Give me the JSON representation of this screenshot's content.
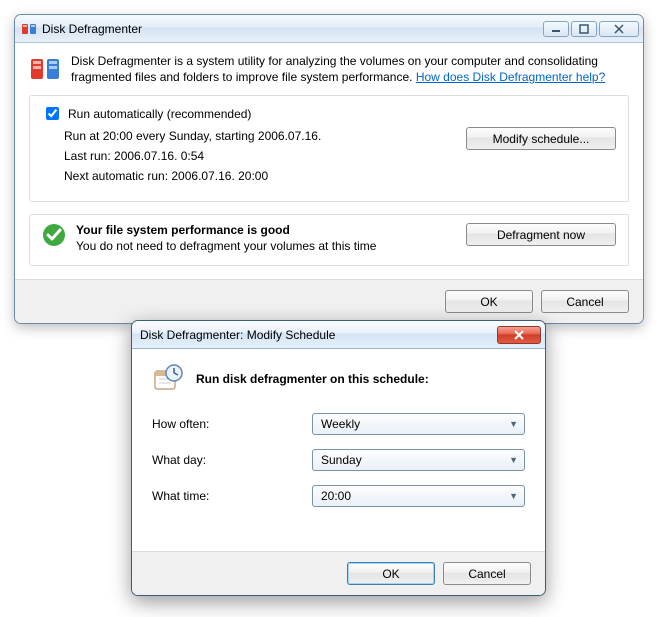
{
  "main": {
    "title": "Disk Defragmenter",
    "intro_text": "Disk Defragmenter is a system utility for analyzing the volumes on your computer and consolidating fragmented files and folders to improve file system performance. ",
    "intro_link": "How does Disk Defragmenter help?",
    "run_auto_label": "Run automatically (recommended)",
    "run_auto_checked": true,
    "schedule_line": "Run at 20:00 every Sunday, starting 2006.07.16.",
    "last_run_line": "Last run: 2006.07.16. 0:54",
    "next_run_line": "Next automatic run: 2006.07.16. 20:00",
    "modify_button": "Modify schedule...",
    "status_title": "Your file system performance is good",
    "status_sub": "You do not need to defragment your volumes at this time",
    "defrag_button": "Defragment now",
    "ok": "OK",
    "cancel": "Cancel"
  },
  "modal": {
    "title": "Disk Defragmenter: Modify Schedule",
    "heading": "Run disk defragmenter on this schedule:",
    "how_often_label": "How often:",
    "how_often_value": "Weekly",
    "what_day_label": "What day:",
    "what_day_value": "Sunday",
    "what_time_label": "What time:",
    "what_time_value": "20:00",
    "ok": "OK",
    "cancel": "Cancel"
  },
  "colors": {
    "link": "#0066cc"
  }
}
